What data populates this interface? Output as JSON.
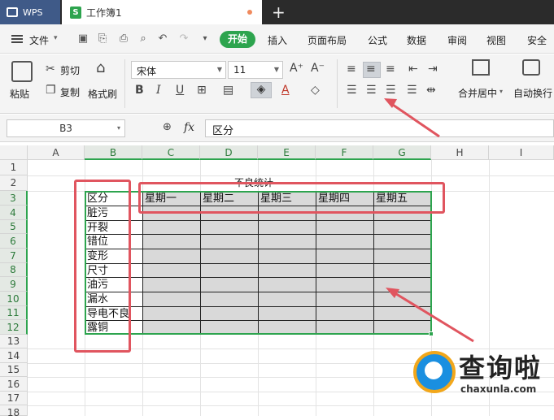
{
  "titlebar": {
    "app_tab": "WPS",
    "doc_tab": "工作簿1"
  },
  "menu": {
    "file": "文件",
    "start": "开始",
    "items": [
      "插入",
      "页面布局",
      "公式",
      "数据",
      "审阅",
      "视图",
      "安全"
    ]
  },
  "ribbon": {
    "paste": "粘贴",
    "cut": "剪切",
    "copy": "复制",
    "format_painter": "格式刷",
    "font_name": "宋体",
    "font_size": "11",
    "merge_center": "合并居中",
    "wrap_text": "自动换行"
  },
  "formula_bar": {
    "cell_ref": "B3",
    "fx": "fx",
    "content": "区分"
  },
  "sheet": {
    "columns": [
      "A",
      "B",
      "C",
      "D",
      "E",
      "F",
      "G",
      "H",
      "I"
    ],
    "rows": [
      "1",
      "2",
      "3",
      "4",
      "5",
      "6",
      "7",
      "8",
      "9",
      "10",
      "11",
      "12",
      "13",
      "14",
      "15",
      "16",
      "17",
      "18"
    ],
    "title": "不良统计",
    "header_b3": "区分",
    "weekdays": [
      "星期一",
      "星期二",
      "星期三",
      "星期四",
      "星期五"
    ],
    "categories": [
      "脏污",
      "开裂",
      "错位",
      "变形",
      "尺寸",
      "油污",
      "漏水",
      "导电不良",
      "露铜"
    ]
  },
  "watermark": {
    "brand": "查询啦",
    "domain": "chaxunla.com"
  },
  "colors": {
    "accent_green": "#2da44e",
    "annotation_red": "#e0555f",
    "table_fill": "#d9d9d9"
  }
}
